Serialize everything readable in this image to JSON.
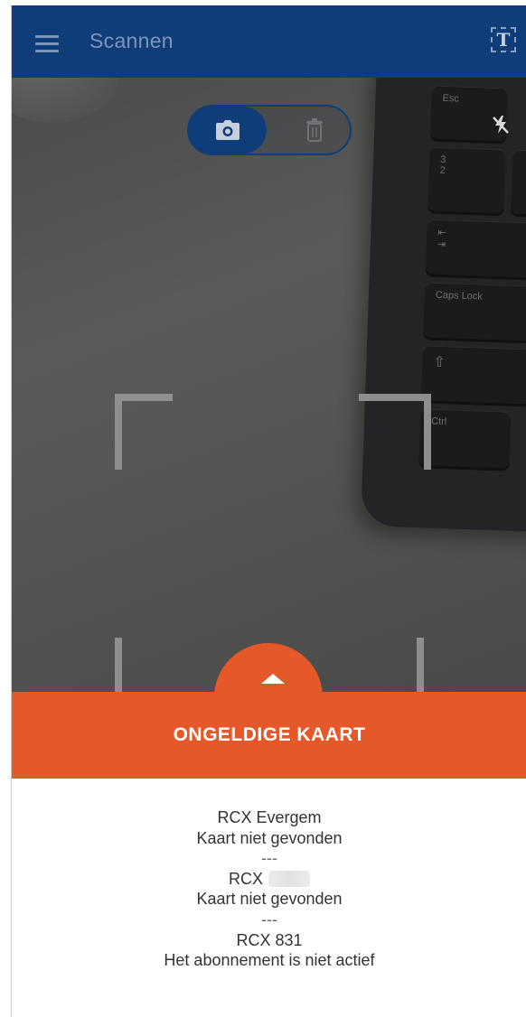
{
  "appbar": {
    "title": "Scannen",
    "menu_icon": "hamburger-menu-icon",
    "text_mode_icon": "T"
  },
  "camera": {
    "toggle": {
      "active_icon": "camera-icon",
      "inactive_icon": "trash-icon"
    },
    "flash_icon": "flash-off-icon",
    "keyboard_keys": [
      "Esc",
      "3\n2",
      "Caps Lock",
      "Ctrl"
    ]
  },
  "result": {
    "status": "ONGELDIGE KAART",
    "lines": [
      {
        "type": "text",
        "value": "RCX Evergem"
      },
      {
        "type": "text",
        "value": "Kaart niet gevonden"
      },
      {
        "type": "sep",
        "value": "---"
      },
      {
        "type": "text",
        "value": "RCX",
        "redacted": true
      },
      {
        "type": "text",
        "value": "Kaart niet gevonden"
      },
      {
        "type": "sep",
        "value": "---"
      },
      {
        "type": "text",
        "value": "RCX 831"
      },
      {
        "type": "text",
        "value": "Het abonnement is niet actief"
      }
    ]
  },
  "colors": {
    "appbar": "#0f3d7a",
    "banner": "#e5582a"
  }
}
